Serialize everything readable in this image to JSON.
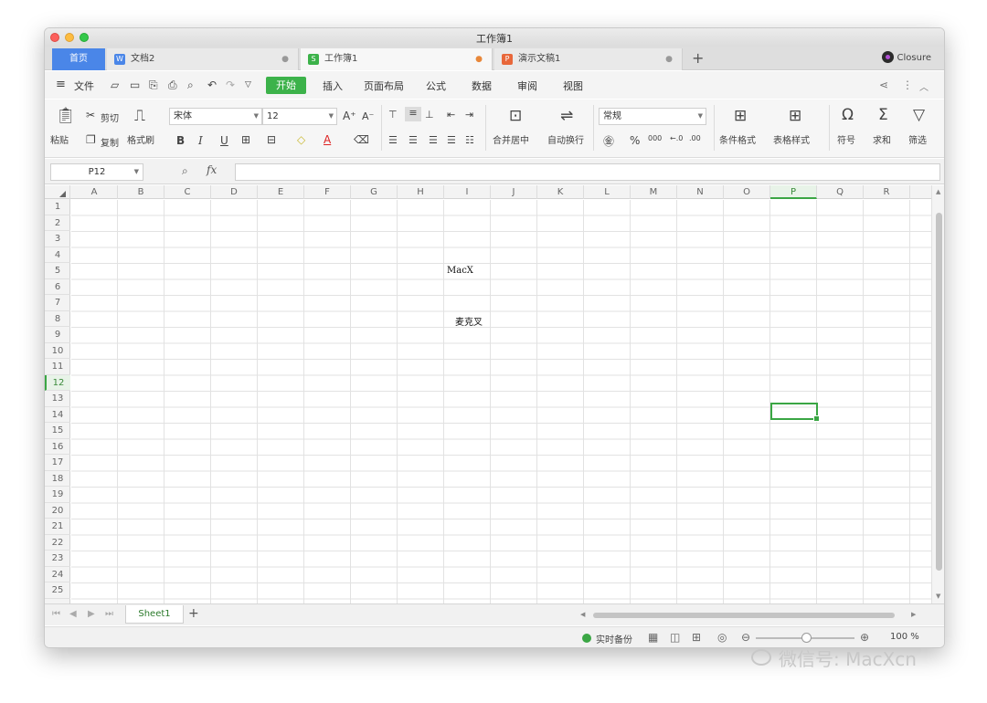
{
  "window": {
    "title": "工作簿1"
  },
  "tabs": {
    "home": "首页",
    "docs": [
      {
        "label": "文档2",
        "icon_text": "W",
        "icon_color": "#4a86e8"
      },
      {
        "label": "工作簿1",
        "icon_text": "S",
        "icon_color": "#3cb24a"
      },
      {
        "label": "演示文稿1",
        "icon_text": "P",
        "icon_color": "#e8673a"
      }
    ],
    "add": "+",
    "user": "Closure"
  },
  "menu": {
    "file": "文件",
    "items": [
      "开始",
      "插入",
      "页面布局",
      "公式",
      "数据",
      "审阅",
      "视图"
    ]
  },
  "ribbon": {
    "cut": "剪切",
    "paste": "粘贴",
    "copy": "复制",
    "format_painter": "格式刷",
    "font_name": "宋体",
    "font_size": "12",
    "bold": "B",
    "italic": "I",
    "underline": "U",
    "merge_center": "合并居中",
    "auto_wrap": "自动换行",
    "number_format": "常规",
    "percent": "%",
    "conditional_format": "条件格式",
    "table_style": "表格样式",
    "symbol": "符号",
    "sum": "求和",
    "filter": "筛选"
  },
  "formula_bar": {
    "name_box": "P12",
    "fx": "fx",
    "value": ""
  },
  "columns": [
    "A",
    "B",
    "C",
    "D",
    "E",
    "F",
    "G",
    "H",
    "I",
    "J",
    "K",
    "L",
    "M",
    "N",
    "O",
    "P",
    "Q",
    "R"
  ],
  "rows": [
    "1",
    "2",
    "3",
    "4",
    "5",
    "6",
    "7",
    "8",
    "9",
    "10",
    "11",
    "12",
    "13",
    "14",
    "15",
    "16",
    "17",
    "18",
    "19",
    "20",
    "21",
    "22",
    "23",
    "24",
    "25"
  ],
  "selected": {
    "column": "P",
    "row": "12"
  },
  "cells": [
    {
      "ref": "I5",
      "value": "MacX"
    },
    {
      "ref": "I8",
      "value": "麦克叉"
    }
  ],
  "sheets": [
    "Sheet1"
  ],
  "status": {
    "backup": "实时备份",
    "zoom": "100 %"
  },
  "watermark": "微信号: MacXcn",
  "colors": {
    "accent": "#3cb24a",
    "home_tab": "#4a86e8",
    "selection": "#3aa644"
  }
}
